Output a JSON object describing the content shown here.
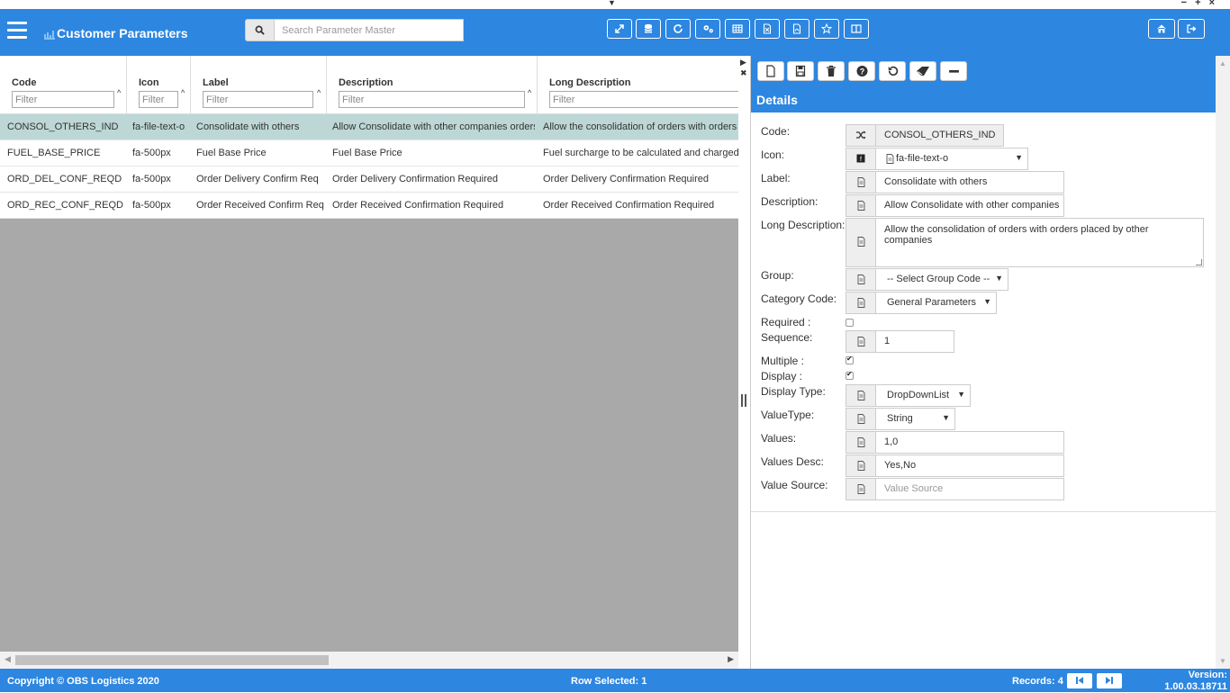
{
  "window": {
    "collapse_glyph": "▼",
    "controls": "− + ×"
  },
  "header": {
    "title": "Customer Parameters",
    "search_placeholder": "Search Parameter Master",
    "toolbar_icons": [
      "expand-icon",
      "database-icon",
      "refresh-icon",
      "settings-icon",
      "grid-icon",
      "export-doc-icon",
      "export-pdf-icon",
      "favorite-icon",
      "columns-icon"
    ],
    "right_icons": [
      "home-icon",
      "logout-icon"
    ]
  },
  "grid": {
    "columns": [
      {
        "title": "Code",
        "filter_placeholder": "Filter"
      },
      {
        "title": "Icon",
        "filter_placeholder": "Filter"
      },
      {
        "title": "Label",
        "filter_placeholder": "Filter"
      },
      {
        "title": "Description",
        "filter_placeholder": "Filter"
      },
      {
        "title": "Long Description",
        "filter_placeholder": "Filter"
      }
    ],
    "rows": [
      {
        "code": "CONSOL_OTHERS_IND",
        "icon": "fa-file-text-o",
        "label": "Consolidate with others",
        "description": "Allow Consolidate with other companies orders",
        "long_description": "Allow the consolidation of orders with orders placed by other companies",
        "selected": true
      },
      {
        "code": "FUEL_BASE_PRICE",
        "icon": "fa-500px",
        "label": "Fuel Base Price",
        "description": "Fuel Base Price",
        "long_description": "Fuel surcharge to be calculated and charged on",
        "selected": false
      },
      {
        "code": "ORD_DEL_CONF_REQD",
        "icon": "fa-500px",
        "label": "Order Delivery Confirm Req",
        "description": "Order Delivery Confirmation Required",
        "long_description": "Order Delivery Confirmation Required",
        "selected": false
      },
      {
        "code": "ORD_REC_CONF_REQD",
        "icon": "fa-500px",
        "label": "Order Received Confirm Req",
        "description": "Order Received Confirmation Required",
        "long_description": "Order Received Confirmation Required",
        "selected": false
      }
    ]
  },
  "details": {
    "title": "Details",
    "toolbar_icons": [
      "new-icon",
      "save-icon",
      "delete-icon",
      "help-icon",
      "undo-icon",
      "eraser-icon",
      "minus-icon"
    ],
    "fields": {
      "code": {
        "label": "Code:",
        "value": "CONSOL_OTHERS_IND"
      },
      "icon": {
        "label": "Icon:",
        "value": "fa-file-text-o"
      },
      "label": {
        "label": "Label:",
        "value": "Consolidate with others"
      },
      "description": {
        "label": "Description:",
        "value": "Allow Consolidate with other companies orders"
      },
      "long_description": {
        "label": "Long Description:",
        "value": "Allow the consolidation of orders with orders placed by other companies"
      },
      "group": {
        "label": "Group:",
        "value": "-- Select Group Code --"
      },
      "category_code": {
        "label": "Category Code:",
        "value": "General Parameters"
      },
      "required": {
        "label": "Required :",
        "checked": false
      },
      "sequence": {
        "label": "Sequence:",
        "value": "1"
      },
      "multiple": {
        "label": "Multiple :",
        "checked": true
      },
      "display": {
        "label": "Display :",
        "checked": true
      },
      "display_type": {
        "label": "Display Type:",
        "value": "DropDownList"
      },
      "value_type": {
        "label": "ValueType:",
        "value": "String"
      },
      "values": {
        "label": "Values:",
        "value": "1,0"
      },
      "values_desc": {
        "label": "Values Desc:",
        "value": "Yes,No"
      },
      "value_source": {
        "label": "Value Source:",
        "placeholder": "Value Source"
      }
    }
  },
  "footer": {
    "copyright": "Copyright © OBS Logistics 2020",
    "row_selected": "Row Selected: 1",
    "records": "Records: 4",
    "version_label": "Version:",
    "version": "1.00.03.18711"
  }
}
